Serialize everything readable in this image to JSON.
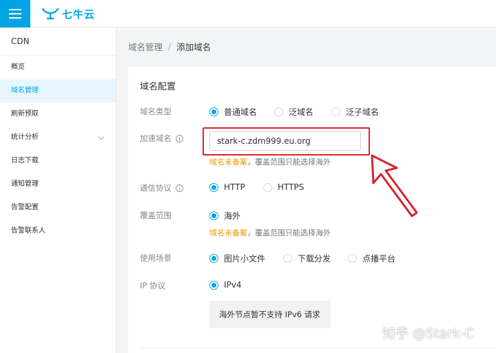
{
  "header": {
    "logo_text": "七牛云",
    "menu_icon": "hamburger-icon",
    "brand_color": "#00a4e4"
  },
  "sidebar": {
    "title": "CDN",
    "items": [
      {
        "label": "概览",
        "active": false
      },
      {
        "label": "域名管理",
        "active": true
      },
      {
        "label": "刷新预取",
        "active": false
      },
      {
        "label": "统计分析",
        "active": false,
        "expandable": true
      },
      {
        "label": "日志下载",
        "active": false
      },
      {
        "label": "通知管理",
        "active": false
      },
      {
        "label": "告警配置",
        "active": false
      },
      {
        "label": "告警联系人",
        "active": false
      }
    ]
  },
  "breadcrumb": {
    "parent": "域名管理",
    "separator": "/",
    "current": "添加域名"
  },
  "form": {
    "section_title": "域名配置",
    "domain_type": {
      "label": "域名类型",
      "options": [
        "普通域名",
        "泛域名",
        "泛子域名"
      ],
      "selected": "普通域名"
    },
    "accel_domain": {
      "label": "加速域名",
      "value": "stark-c.zdm999.eu.org",
      "hint_warn": "域名未备案",
      "hint_text": "，覆盖范围只能选择海外"
    },
    "protocol": {
      "label": "通信协议",
      "options": [
        "HTTP",
        "HTTPS"
      ],
      "selected": "HTTP"
    },
    "coverage": {
      "label": "覆盖范围",
      "options": [
        "海外"
      ],
      "selected": "海外",
      "hint_warn": "域名未备案",
      "hint_text": "，覆盖范围只能选择海外"
    },
    "scenario": {
      "label": "使用场景",
      "options": [
        "图片小文件",
        "下载分发",
        "点播平台"
      ],
      "selected": "图片小文件"
    },
    "ip_protocol": {
      "label": "IP 协议",
      "options": [
        "IPv4"
      ],
      "selected": "IPv4",
      "notice": "海外节点暂不支持 IPv6 请求"
    }
  },
  "annotation": {
    "highlight_color": "#d9232e"
  },
  "watermark": "知乎 @Stark-C"
}
